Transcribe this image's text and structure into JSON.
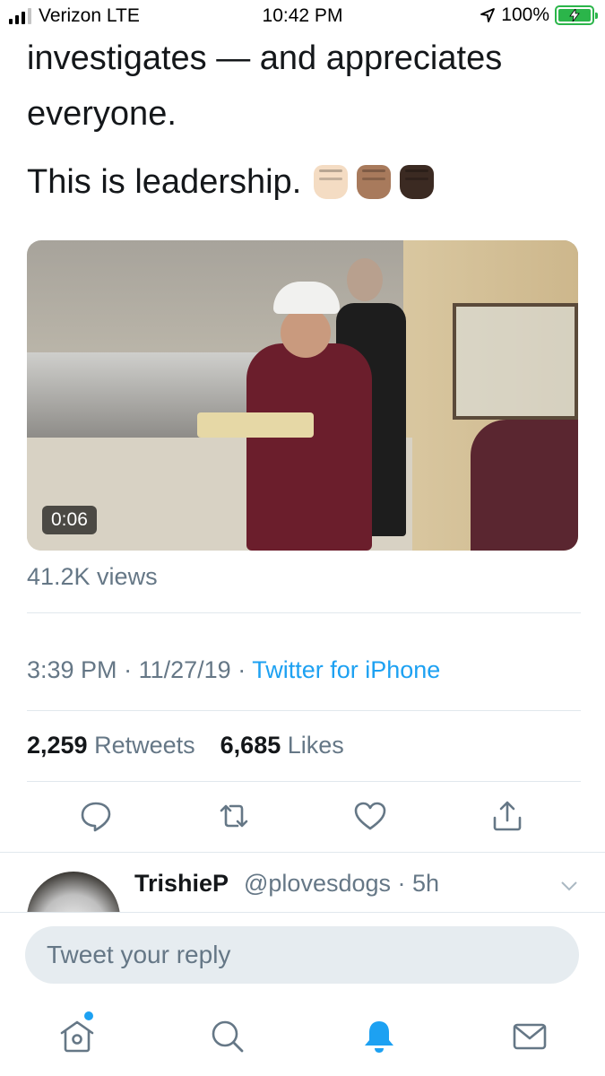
{
  "status_bar": {
    "carrier": "Verizon LTE",
    "time": "10:42 PM",
    "battery": "100%"
  },
  "tweet": {
    "text_line1": "investigates — and appreciates",
    "text_line2": "everyone.",
    "text_para2": "This is leadership.",
    "emoji": [
      "raised-fist-light",
      "raised-fist-medium",
      "raised-fist-dark"
    ],
    "video": {
      "duration": "0:06"
    },
    "views": "41.2K views",
    "time": "3:39 PM",
    "date": "11/27/19",
    "separator": "·",
    "source": "Twitter for iPhone",
    "retweets_count": "2,259",
    "retweets_label": "Retweets",
    "likes_count": "6,685",
    "likes_label": "Likes"
  },
  "actions": [
    "reply-icon",
    "retweet-icon",
    "like-icon",
    "share-icon"
  ],
  "reply": {
    "name": "TrishieP",
    "handle": "@plovesdogs",
    "time": "5h"
  },
  "reply_bar": {
    "placeholder": "Tweet your reply"
  },
  "tabs": [
    "home-icon",
    "search-icon",
    "notifications-icon",
    "messages-icon"
  ],
  "colors": {
    "accent": "#1da1f2",
    "text": "#14171a",
    "secondary": "#657786",
    "battery": "#2bb54a"
  }
}
